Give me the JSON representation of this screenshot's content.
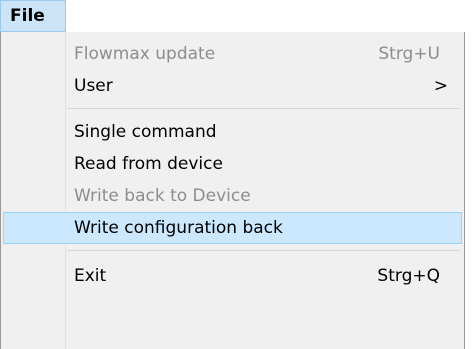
{
  "menubar": {
    "file_label": "File"
  },
  "menu": {
    "items": [
      {
        "label": "Flowmax update",
        "shortcut": "Strg+U",
        "state": "disabled"
      },
      {
        "label": "User",
        "submenu_glyph": ">",
        "state": "enabled"
      },
      {
        "label": "Single command",
        "state": "enabled"
      },
      {
        "label": "Read from device",
        "state": "enabled"
      },
      {
        "label": "Write back to Device",
        "state": "disabled"
      },
      {
        "label": "Write configuration back",
        "state": "highlighted"
      },
      {
        "label": "Exit",
        "shortcut": "Strg+Q",
        "state": "enabled"
      }
    ]
  },
  "colors": {
    "highlight": "#cce8ff",
    "disabled_text": "#8d8d8d",
    "menu_background": "#f0f0f0"
  }
}
